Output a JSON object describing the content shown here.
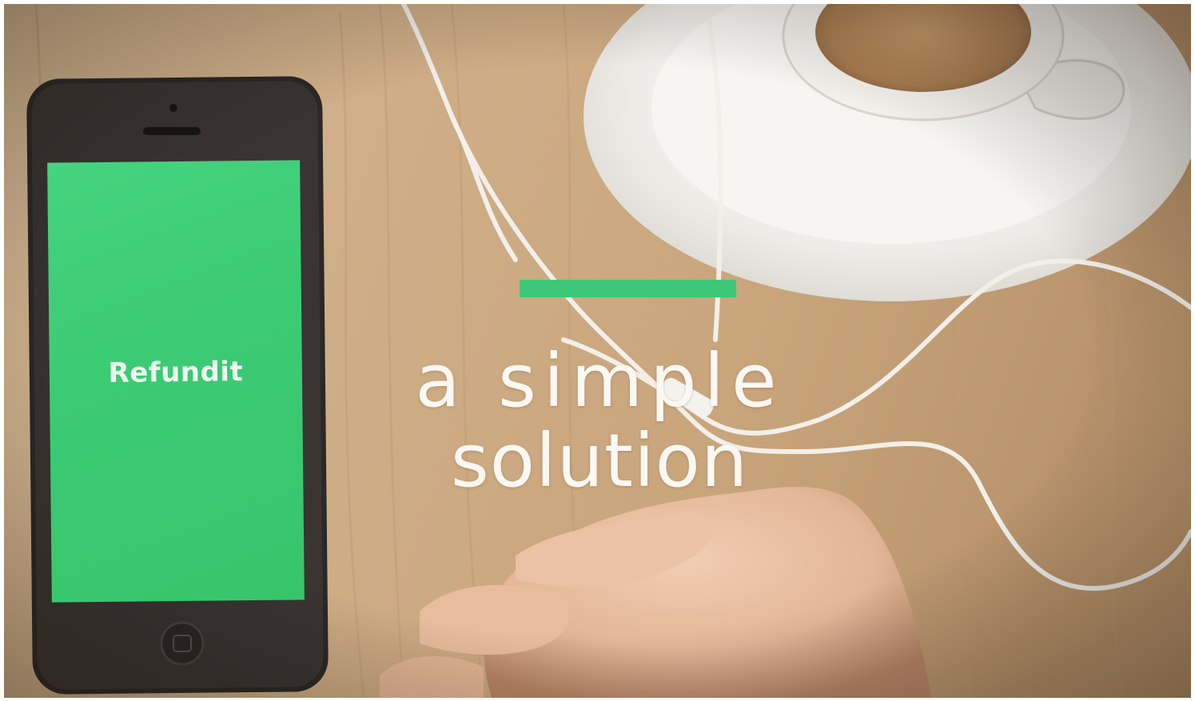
{
  "phone": {
    "app_name": "Refundit",
    "screen_color": "#3cc976"
  },
  "overlay": {
    "accent_color": "#3cc878",
    "line1": "a simple",
    "line2": "solution"
  },
  "scene_objects": [
    "smartphone",
    "coffee-cup-on-saucer",
    "earphone-cable",
    "hand",
    "wooden-table"
  ]
}
